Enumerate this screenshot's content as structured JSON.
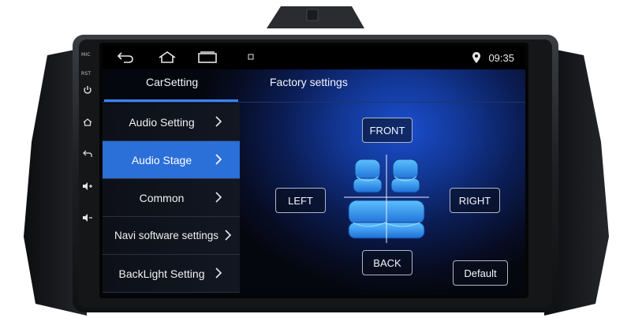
{
  "side_buttons": {
    "mic_label": "MIC",
    "rst_label": "RST"
  },
  "statusbar": {
    "time": "09:35",
    "icons": [
      "back-arrow-icon",
      "home-icon",
      "recent-apps-icon",
      "notification-icon",
      "location-pin-icon"
    ]
  },
  "tabs": [
    {
      "label": "CarSetting",
      "active": true
    },
    {
      "label": "Factory settings",
      "active": false
    }
  ],
  "menu": {
    "items": [
      {
        "label": "Audio Setting",
        "active": false
      },
      {
        "label": "Audio Stage",
        "active": true
      },
      {
        "label": "Common",
        "active": false
      },
      {
        "label": "Navi software settings",
        "active": false
      },
      {
        "label": "BackLight Setting",
        "active": false
      }
    ]
  },
  "audio_stage": {
    "front_label": "FRONT",
    "left_label": "LEFT",
    "right_label": "RIGHT",
    "back_label": "BACK",
    "default_label": "Default"
  },
  "colors": {
    "accent": "#2b6fd8",
    "seat_glow": "#3fa8ff"
  }
}
